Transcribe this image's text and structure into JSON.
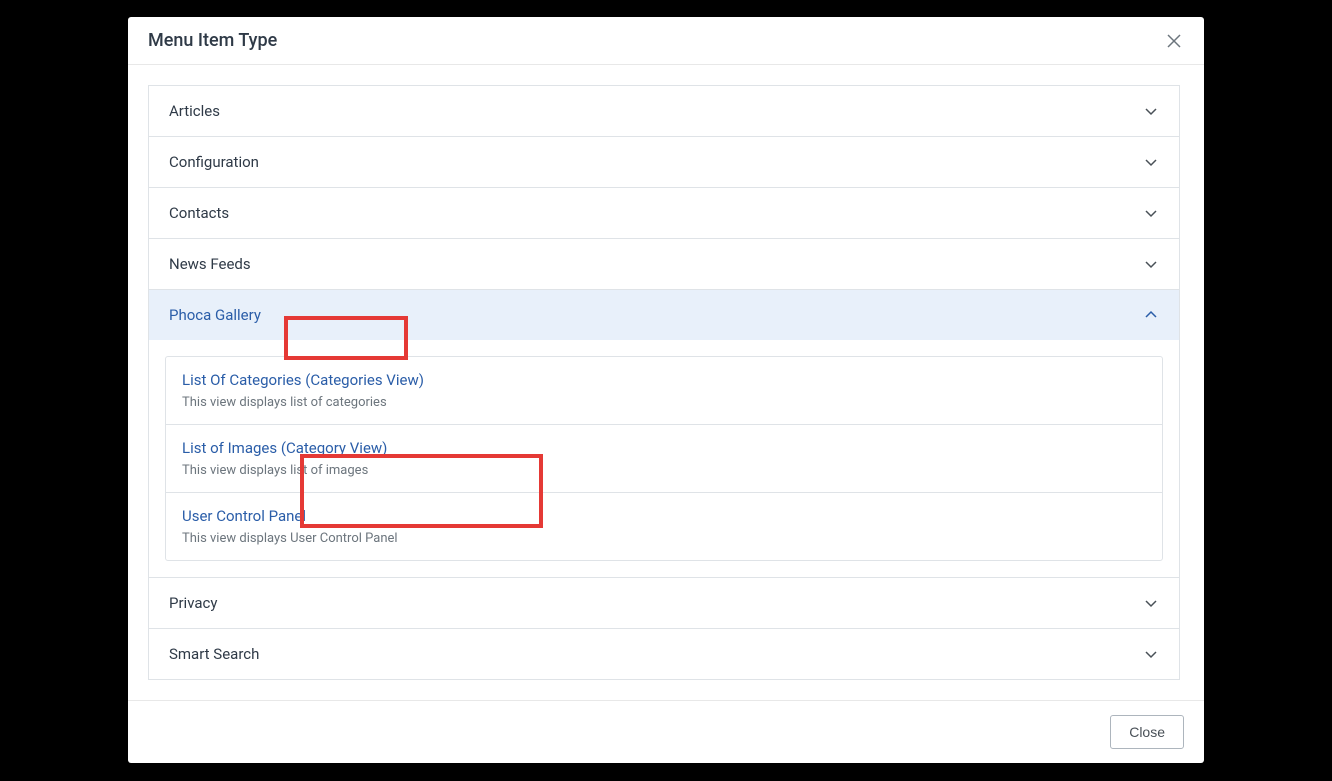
{
  "modal": {
    "title": "Menu Item Type",
    "close_button": "Close"
  },
  "sections": [
    {
      "label": "Articles"
    },
    {
      "label": "Configuration"
    },
    {
      "label": "Contacts"
    },
    {
      "label": "News Feeds"
    },
    {
      "label": "Phoca Gallery",
      "expanded": true
    },
    {
      "label": "Privacy"
    },
    {
      "label": "Smart Search"
    }
  ],
  "phoca_options": [
    {
      "title": "List Of Categories (Categories View)",
      "desc": "This view displays list of categories"
    },
    {
      "title": "List of Images (Category View)",
      "desc": "This view displays list of images"
    },
    {
      "title": "User Control Panel",
      "desc": "This view displays User Control Panel"
    }
  ]
}
